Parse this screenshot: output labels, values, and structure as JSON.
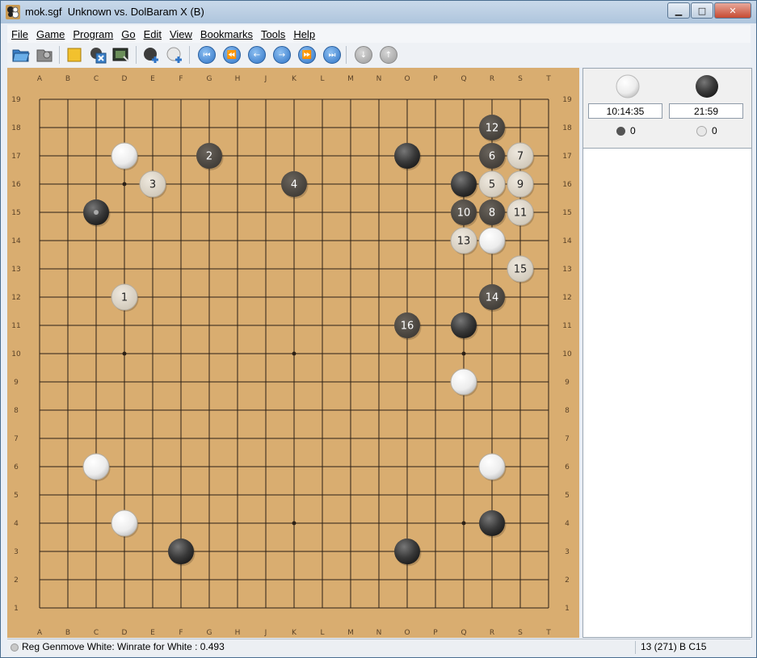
{
  "window": {
    "title": "mok.sgf  Unknown vs. DolBaram X (B)"
  },
  "menu": [
    "File",
    "Game",
    "Program",
    "Go",
    "Edit",
    "View",
    "Bookmarks",
    "Tools",
    "Help"
  ],
  "toolbar": {
    "buttons": [
      "open-icon",
      "save-icon",
      "new-game-icon",
      "close-game-icon",
      "edit-icon",
      "add-black-stone-icon",
      "add-white-stone-icon",
      "first-move-icon",
      "back-ten-icon",
      "back-one-icon",
      "forward-one-icon",
      "forward-ten-icon",
      "last-move-icon",
      "previous-variation-icon",
      "next-variation-icon"
    ]
  },
  "board": {
    "size": 19,
    "columns": [
      "A",
      "B",
      "C",
      "D",
      "E",
      "F",
      "G",
      "H",
      "J",
      "K",
      "L",
      "M",
      "N",
      "O",
      "P",
      "Q",
      "R",
      "S",
      "T"
    ],
    "rows": [
      "19",
      "18",
      "17",
      "16",
      "15",
      "14",
      "13",
      "12",
      "11",
      "10",
      "9",
      "8",
      "7",
      "6",
      "5",
      "4",
      "3",
      "2",
      "1"
    ],
    "colors": {
      "wood": "#d9ad70",
      "line": "#2b2016",
      "black_stone": "#3f3f3f",
      "white_stone": "#f2f2f2",
      "white_numbered": "#ddd6c9",
      "black_numbered": "#555049"
    },
    "hoshi": [
      "D16",
      "K16",
      "Q16",
      "D10",
      "K10",
      "Q10",
      "D4",
      "K4",
      "Q4"
    ],
    "stones": [
      {
        "point": "D17",
        "color": "white",
        "label": ""
      },
      {
        "point": "G17",
        "color": "black",
        "label": "2"
      },
      {
        "point": "O17",
        "color": "black",
        "label": ""
      },
      {
        "point": "R18",
        "color": "black",
        "label": "12"
      },
      {
        "point": "R17",
        "color": "black",
        "label": "6"
      },
      {
        "point": "S17",
        "color": "white",
        "label": "7"
      },
      {
        "point": "E16",
        "color": "white",
        "label": "3"
      },
      {
        "point": "K16",
        "color": "black",
        "label": "4"
      },
      {
        "point": "Q16",
        "color": "black",
        "label": ""
      },
      {
        "point": "R16",
        "color": "white",
        "label": "5"
      },
      {
        "point": "S16",
        "color": "white",
        "label": "9"
      },
      {
        "point": "C15",
        "color": "black",
        "label": "",
        "last": true
      },
      {
        "point": "Q15",
        "color": "black",
        "label": "10"
      },
      {
        "point": "R15",
        "color": "black",
        "label": "8"
      },
      {
        "point": "S15",
        "color": "white",
        "label": "11"
      },
      {
        "point": "Q14",
        "color": "white",
        "label": "13"
      },
      {
        "point": "R14",
        "color": "white",
        "label": ""
      },
      {
        "point": "S13",
        "color": "white",
        "label": "15"
      },
      {
        "point": "D12",
        "color": "white",
        "label": "1"
      },
      {
        "point": "R12",
        "color": "black",
        "label": "14"
      },
      {
        "point": "O11",
        "color": "black",
        "label": "16"
      },
      {
        "point": "Q11",
        "color": "black",
        "label": ""
      },
      {
        "point": "Q9",
        "color": "white",
        "label": ""
      },
      {
        "point": "C6",
        "color": "white",
        "label": ""
      },
      {
        "point": "R6",
        "color": "white",
        "label": ""
      },
      {
        "point": "D4",
        "color": "white",
        "label": ""
      },
      {
        "point": "R4",
        "color": "black",
        "label": ""
      },
      {
        "point": "F3",
        "color": "black",
        "label": ""
      },
      {
        "point": "O3",
        "color": "black",
        "label": ""
      }
    ]
  },
  "players": {
    "white": {
      "time": "10:14:35",
      "captures": "0"
    },
    "black": {
      "time": "21:59",
      "captures": "0"
    }
  },
  "status": {
    "message": "Reg Genmove White: Winrate for White : 0.493",
    "move_info": "13 (271) B C15"
  }
}
